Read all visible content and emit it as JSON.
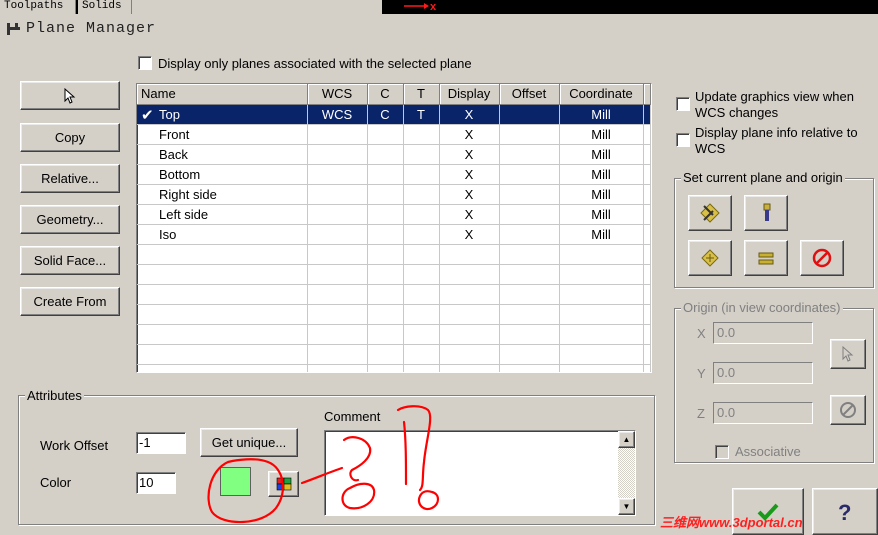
{
  "top_tabs": [
    "Toolpaths",
    "Solids"
  ],
  "top_marker": "x",
  "dialog_title": "Plane Manager",
  "filter_checkbox_label": "Display only planes associated with the selected plane",
  "left_buttons": [
    "Copy",
    "Relative...",
    "Geometry...",
    "Solid Face...",
    "Create From"
  ],
  "table": {
    "columns": [
      "Name",
      "WCS",
      "C",
      "T",
      "Display",
      "Offset",
      "Coordinate"
    ],
    "rows": [
      {
        "name": "Top",
        "wcs": "WCS",
        "c": "C",
        "t": "T",
        "display": "X",
        "offset": "",
        "coord": "Mill",
        "selected": true
      },
      {
        "name": "Front",
        "wcs": "",
        "c": "",
        "t": "",
        "display": "X",
        "offset": "",
        "coord": "Mill"
      },
      {
        "name": "Back",
        "wcs": "",
        "c": "",
        "t": "",
        "display": "X",
        "offset": "",
        "coord": "Mill"
      },
      {
        "name": "Bottom",
        "wcs": "",
        "c": "",
        "t": "",
        "display": "X",
        "offset": "",
        "coord": "Mill"
      },
      {
        "name": "Right side",
        "wcs": "",
        "c": "",
        "t": "",
        "display": "X",
        "offset": "",
        "coord": "Mill"
      },
      {
        "name": "Left side",
        "wcs": "",
        "c": "",
        "t": "",
        "display": "X",
        "offset": "",
        "coord": "Mill"
      },
      {
        "name": "Iso",
        "wcs": "",
        "c": "",
        "t": "",
        "display": "X",
        "offset": "",
        "coord": "Mill"
      }
    ]
  },
  "options": {
    "update_graphics_label": "Update graphics view when WCS changes",
    "display_info_label": "Display plane info relative to WCS"
  },
  "set_current": {
    "title": "Set current plane and origin"
  },
  "origin": {
    "title": "Origin (in view coordinates)",
    "x_label": "X",
    "y_label": "Y",
    "z_label": "Z",
    "x_value": "0.0",
    "y_value": "0.0",
    "z_value": "0.0",
    "associative_label": "Associative"
  },
  "attributes": {
    "title": "Attributes",
    "work_offset_label": "Work Offset",
    "work_offset_value": "-1",
    "get_unique_label": "Get unique...",
    "color_label": "Color",
    "color_value": "10",
    "swatch_color": "#80ff80",
    "comment_label": "Comment"
  },
  "watermark": "三维网www.3dportal.cn",
  "colors": {
    "selection": "#0a246a",
    "annotation": "#ff0000",
    "ok_check": "#1a9a1a"
  }
}
